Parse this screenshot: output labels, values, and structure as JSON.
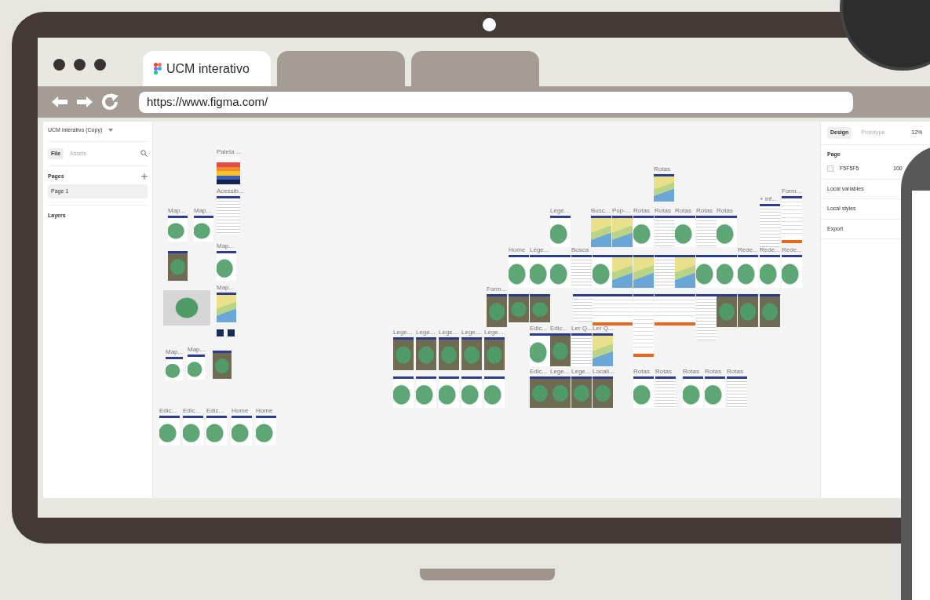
{
  "browser": {
    "tabs": [
      {
        "label": "UCM interativo",
        "selected": true
      },
      {
        "selected": false
      },
      {
        "selected": false
      }
    ],
    "url": "https://www.figma.com/"
  },
  "left_panel": {
    "file_name": "UCM interativo (Copy)",
    "tabs": [
      {
        "label": "File",
        "selected": true
      },
      {
        "label": "Assets",
        "selected": false
      }
    ],
    "pages_heading": "Pages",
    "pages": [
      {
        "label": "Page 1",
        "selected": true
      }
    ],
    "layers_heading": "Layers"
  },
  "right_panel": {
    "tabs": [
      {
        "label": "Design",
        "selected": true
      },
      {
        "label": "Prototype",
        "selected": false
      }
    ],
    "zoom": "12%",
    "page_heading": "Page",
    "page_color": {
      "value": "F5F5F5",
      "opacity": "100",
      "color": "#f5f5f5"
    },
    "sections": [
      "Local variables",
      "Local styles",
      "Export"
    ]
  },
  "canvas": {
    "frames": [
      {
        "label": "Paleta ...",
        "kind": "palette"
      },
      {
        "label": "Acessib...",
        "kind": "doc"
      },
      {
        "label": "Map...",
        "kind": "map"
      },
      {
        "label": "Map...",
        "kind": "map"
      },
      {
        "kind": "photo"
      },
      {
        "label": "Map...",
        "kind": "map"
      },
      {
        "kind": "grey"
      },
      {
        "label": "Map...",
        "kind": "plan"
      },
      {
        "kind": "tile"
      },
      {
        "kind": "tile"
      },
      {
        "label": "Map...",
        "kind": "map"
      },
      {
        "label": "Map...",
        "kind": "map"
      },
      {
        "kind": "photo"
      },
      {
        "label": "Edic...",
        "kind": "map"
      },
      {
        "label": "Edic...",
        "kind": "map"
      },
      {
        "label": "Edic...",
        "kind": "map"
      },
      {
        "label": "Home",
        "kind": "map"
      },
      {
        "label": "Home",
        "kind": "map"
      },
      {
        "label": "Lege...",
        "kind": "photo"
      },
      {
        "label": "Lege...",
        "kind": "photo"
      },
      {
        "label": "Lege...",
        "kind": "photo"
      },
      {
        "label": "Lege...",
        "kind": "photo"
      },
      {
        "label": "Lege...",
        "kind": "photo"
      },
      {
        "kind": "map"
      },
      {
        "kind": "map"
      },
      {
        "kind": "map"
      },
      {
        "kind": "map"
      },
      {
        "kind": "map"
      },
      {
        "label": "Rotas",
        "kind": "plan"
      },
      {
        "label": "Lege...",
        "kind": "map"
      },
      {
        "label": "Busc...",
        "kind": "plan"
      },
      {
        "label": "Pop-...",
        "kind": "plan"
      },
      {
        "label": "Rotas",
        "kind": "map"
      },
      {
        "label": "Rotas",
        "kind": "doc"
      },
      {
        "label": "Rotas",
        "kind": "map"
      },
      {
        "label": "Rotas",
        "kind": "doc"
      },
      {
        "label": "Rotas",
        "kind": "map"
      },
      {
        "label": "+ inf...",
        "kind": "doc"
      },
      {
        "label": "Form...",
        "kind": "form"
      },
      {
        "label": "Home",
        "kind": "map"
      },
      {
        "label": "Lege...",
        "kind": "map"
      },
      {
        "kind": "map"
      },
      {
        "label": "Busca",
        "kind": "doc"
      },
      {
        "kind": "map"
      },
      {
        "kind": "plan"
      },
      {
        "kind": "plan"
      },
      {
        "kind": "doc"
      },
      {
        "kind": "plan"
      },
      {
        "kind": "map"
      },
      {
        "kind": "map"
      },
      {
        "label": "Rede...",
        "kind": "map"
      },
      {
        "label": "Rede...",
        "kind": "map"
      },
      {
        "label": "Rede...",
        "kind": "map"
      },
      {
        "label": "Form...",
        "kind": "photo"
      },
      {
        "kind": "photo"
      },
      {
        "kind": "photo"
      },
      {
        "kind": "doc"
      },
      {
        "kind": "form"
      },
      {
        "kind": "form"
      },
      {
        "kind": "form"
      },
      {
        "kind": "form"
      },
      {
        "kind": "form"
      },
      {
        "kind": "doc"
      },
      {
        "kind": "photo"
      },
      {
        "kind": "photo"
      },
      {
        "kind": "photo"
      },
      {
        "label": "Edic...",
        "kind": "map"
      },
      {
        "label": "Edic...",
        "kind": "photo"
      },
      {
        "label": "Ler Q...",
        "kind": "doc"
      },
      {
        "label": "Ler Q...",
        "kind": "plan"
      },
      {
        "label": "Edic...",
        "kind": "photo"
      },
      {
        "label": "Lege...",
        "kind": "photo"
      },
      {
        "label": "Lege...",
        "kind": "photo"
      },
      {
        "label": "Locali...",
        "kind": "photo"
      },
      {
        "label": "Rotas",
        "kind": "map"
      },
      {
        "label": "Rotas",
        "kind": "doc"
      },
      {
        "label": "Rotas",
        "kind": "map"
      },
      {
        "label": "Rotas",
        "kind": "map"
      },
      {
        "label": "Rotas",
        "kind": "doc"
      }
    ]
  }
}
